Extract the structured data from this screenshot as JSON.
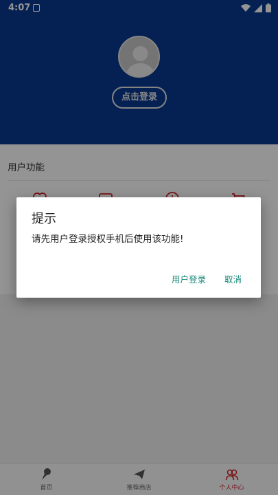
{
  "status_bar": {
    "time": "4:07"
  },
  "header": {
    "login_button": "点击登录"
  },
  "section": {
    "title": "用户功能"
  },
  "dialog": {
    "title": "提示",
    "message": "请先用户登录授权手机后使用该功能!",
    "confirm_label": "用户登录",
    "cancel_label": "取消",
    "accent_color": "#1a8a7d"
  },
  "bottom_nav": {
    "items": [
      {
        "label": "首页",
        "icon": "ice-cream-icon"
      },
      {
        "label": "推荐商店",
        "icon": "paper-plane-icon"
      },
      {
        "label": "个人中心",
        "icon": "users-icon",
        "active": true
      }
    ]
  },
  "colors": {
    "header_bg": "#0a3a8f",
    "nav_active": "#d2232a"
  }
}
